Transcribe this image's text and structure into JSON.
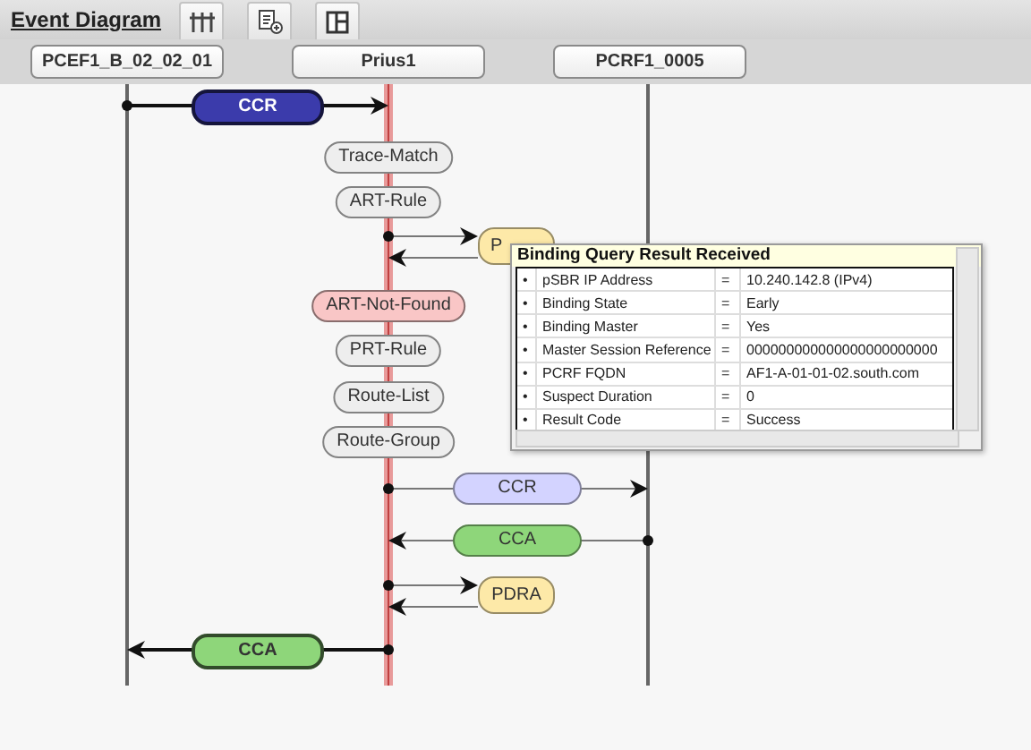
{
  "toolbar": {
    "title": "Event Diagram"
  },
  "lanes": [
    {
      "name": "PCEF1_B_02_02_01",
      "active": false
    },
    {
      "name": "Prius1",
      "active": true
    },
    {
      "name": "PCRF1_0005",
      "active": false
    }
  ],
  "events": [
    {
      "kind": "in-left",
      "label": "CCR",
      "bold": true,
      "color": "#3b3bab"
    },
    {
      "kind": "step",
      "label": "Trace-Match",
      "color": "#eeeeee"
    },
    {
      "kind": "step",
      "label": "ART-Rule",
      "color": "#eeeeee"
    },
    {
      "kind": "roundtrip",
      "label": "P",
      "color": "#fde9a8",
      "obscured": true
    },
    {
      "kind": "step",
      "label": "ART-Not-Found",
      "color": "#f9c6c6"
    },
    {
      "kind": "step",
      "label": "PRT-Rule",
      "color": "#eeeeee"
    },
    {
      "kind": "step",
      "label": "Route-List",
      "color": "#eeeeee"
    },
    {
      "kind": "step",
      "label": "Route-Group",
      "color": "#eeeeee"
    },
    {
      "kind": "out-right",
      "label": "CCR",
      "bold": false,
      "color": "#d3d3ff"
    },
    {
      "kind": "in-right",
      "label": "CCA",
      "bold": false,
      "color": "#8ed67a"
    },
    {
      "kind": "roundtrip",
      "label": "PDRA",
      "color": "#fde9a8",
      "obscured": false
    },
    {
      "kind": "out-left",
      "label": "CCA",
      "bold": true,
      "color": "#8ed67a"
    }
  ],
  "popup": {
    "title": "Binding Query Result Received",
    "rows": [
      {
        "bullet": "•",
        "name": "pSBR IP Address",
        "sign": "=",
        "value": "10.240.142.8 (IPv4)"
      },
      {
        "bullet": "•",
        "name": "Binding State",
        "sign": "=",
        "value": "Early"
      },
      {
        "bullet": "•",
        "name": "Binding Master",
        "sign": "=",
        "value": "Yes"
      },
      {
        "bullet": "•",
        "name": "Master Session Reference",
        "sign": "=",
        "value": "000000000000000000000000"
      },
      {
        "bullet": "•",
        "name": "PCRF FQDN",
        "sign": "=",
        "value": "AF1-A-01-01-02.south.com"
      },
      {
        "bullet": "•",
        "name": "Suspect Duration",
        "sign": "=",
        "value": "0"
      },
      {
        "bullet": "•",
        "name": "Result Code",
        "sign": "=",
        "value": "Success"
      }
    ]
  }
}
